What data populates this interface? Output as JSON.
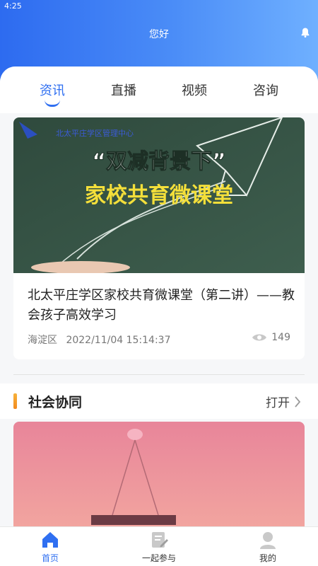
{
  "status_bar": {
    "time": "4:25"
  },
  "header": {
    "greeting": "您好",
    "bell_icon": "bell-icon"
  },
  "tabs": [
    {
      "label": "资讯",
      "active": true
    },
    {
      "label": "直播",
      "active": false
    },
    {
      "label": "视频",
      "active": false
    },
    {
      "label": "咨询",
      "active": false
    }
  ],
  "news_card": {
    "image": {
      "logo_text": "北太平庄学区管理中心",
      "headline": "“双减背景下”",
      "subline": "家校共育微课堂"
    },
    "title": "北太平庄学区家校共育微课堂（第二讲）——教会孩子高效学习",
    "district": "海淀区",
    "datetime": "2022/11/04 15:14:37",
    "views": "149",
    "views_icon": "eye-icon"
  },
  "section": {
    "title": "社会协同",
    "open_label": "打开",
    "open_icon": "chevron-right-icon"
  },
  "bottom_nav": [
    {
      "label": "首页",
      "icon": "home-icon",
      "active": true
    },
    {
      "label": "一起参与",
      "icon": "edit-note-icon",
      "active": false
    },
    {
      "label": "我的",
      "icon": "user-icon",
      "active": false
    }
  ],
  "colors": {
    "accent": "#2f6ff1",
    "header_start": "#2d6bf0",
    "header_end": "#6fb0ff",
    "section_bar": "#f7b23a"
  }
}
